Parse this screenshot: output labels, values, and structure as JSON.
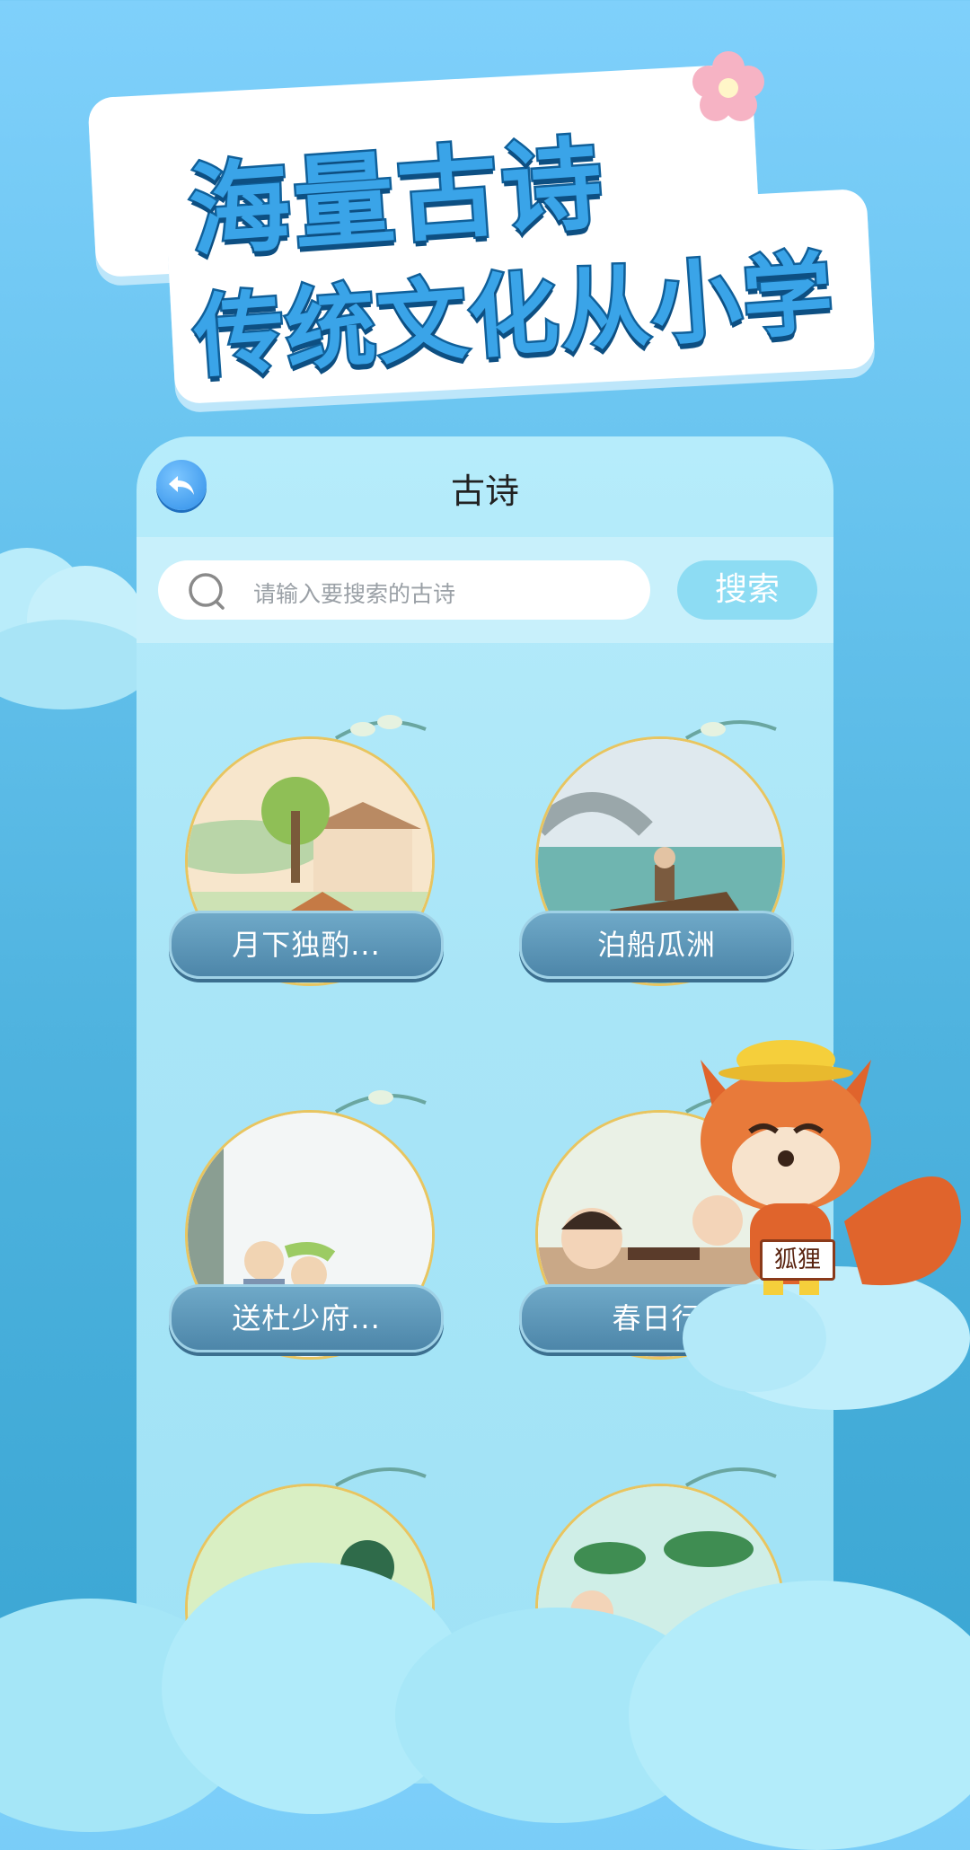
{
  "banner": {
    "line1": "海量古诗",
    "line2": "传统文化从小学"
  },
  "screen": {
    "title": "古诗",
    "search": {
      "placeholder": "请输入要搜索的古诗",
      "button": "搜索"
    },
    "poems": [
      {
        "title": "月下独酌..."
      },
      {
        "title": "泊船瓜洲"
      },
      {
        "title": "送杜少府..."
      },
      {
        "title": "春日行"
      }
    ]
  },
  "mascot": {
    "sign": "狐狸"
  },
  "colors": {
    "accent": "#2f8ee8",
    "search_button": "#8ddcf3",
    "label_bg": "#4d86a9",
    "headline_fill": "#3aa4e8"
  },
  "icons": [
    "back-icon",
    "search-icon",
    "flower-icon"
  ]
}
